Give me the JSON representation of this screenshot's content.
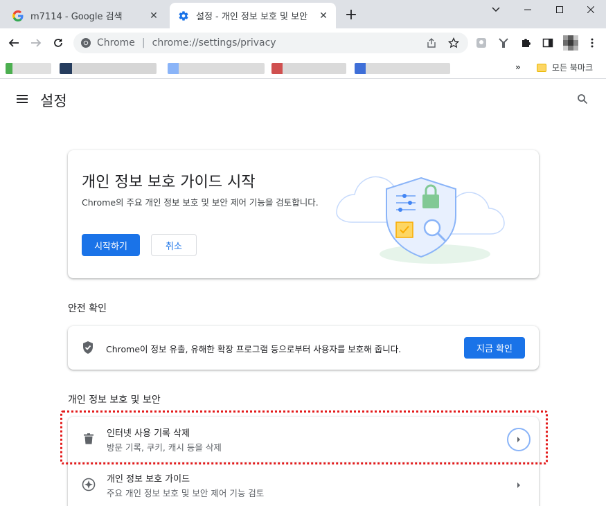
{
  "tabs": [
    {
      "title": "m7114 - Google 검색",
      "favicon": "google-g-icon",
      "active": false
    },
    {
      "title": "설정 - 개인 정보 보호 및 보안",
      "favicon": "gear-icon",
      "active": true
    }
  ],
  "toolbar": {
    "site_chip": "Chrome",
    "url": "chrome://settings/privacy"
  },
  "bookmarks": {
    "more": "»",
    "folder_label": "모든 북마크"
  },
  "settings": {
    "title": "설정"
  },
  "guide": {
    "title": "개인 정보 보호 가이드 시작",
    "description": "Chrome의 주요 개인 정보 보호 및 보안 제어 기능을 검토합니다.",
    "start_label": "시작하기",
    "cancel_label": "취소"
  },
  "safety": {
    "section_label": "안전 확인",
    "text": "Chrome이 정보 유출, 유해한 확장 프로그램 등으로부터 사용자를 보호해 줍니다.",
    "check_label": "지금 확인"
  },
  "privacy": {
    "section_label": "개인 정보 보호 및 보안",
    "rows": [
      {
        "title": "인터넷 사용 기록 삭제",
        "subtitle": "방문 기록, 쿠키, 캐시 등을 삭제",
        "icon": "trash-icon"
      },
      {
        "title": "개인 정보 보호 가이드",
        "subtitle": "주요 개인 정보 보호 및 보안 제어 기능 검토",
        "icon": "compass-icon"
      }
    ]
  },
  "colors": {
    "accent": "#1a73e8",
    "highlight": "#e31b1b"
  }
}
